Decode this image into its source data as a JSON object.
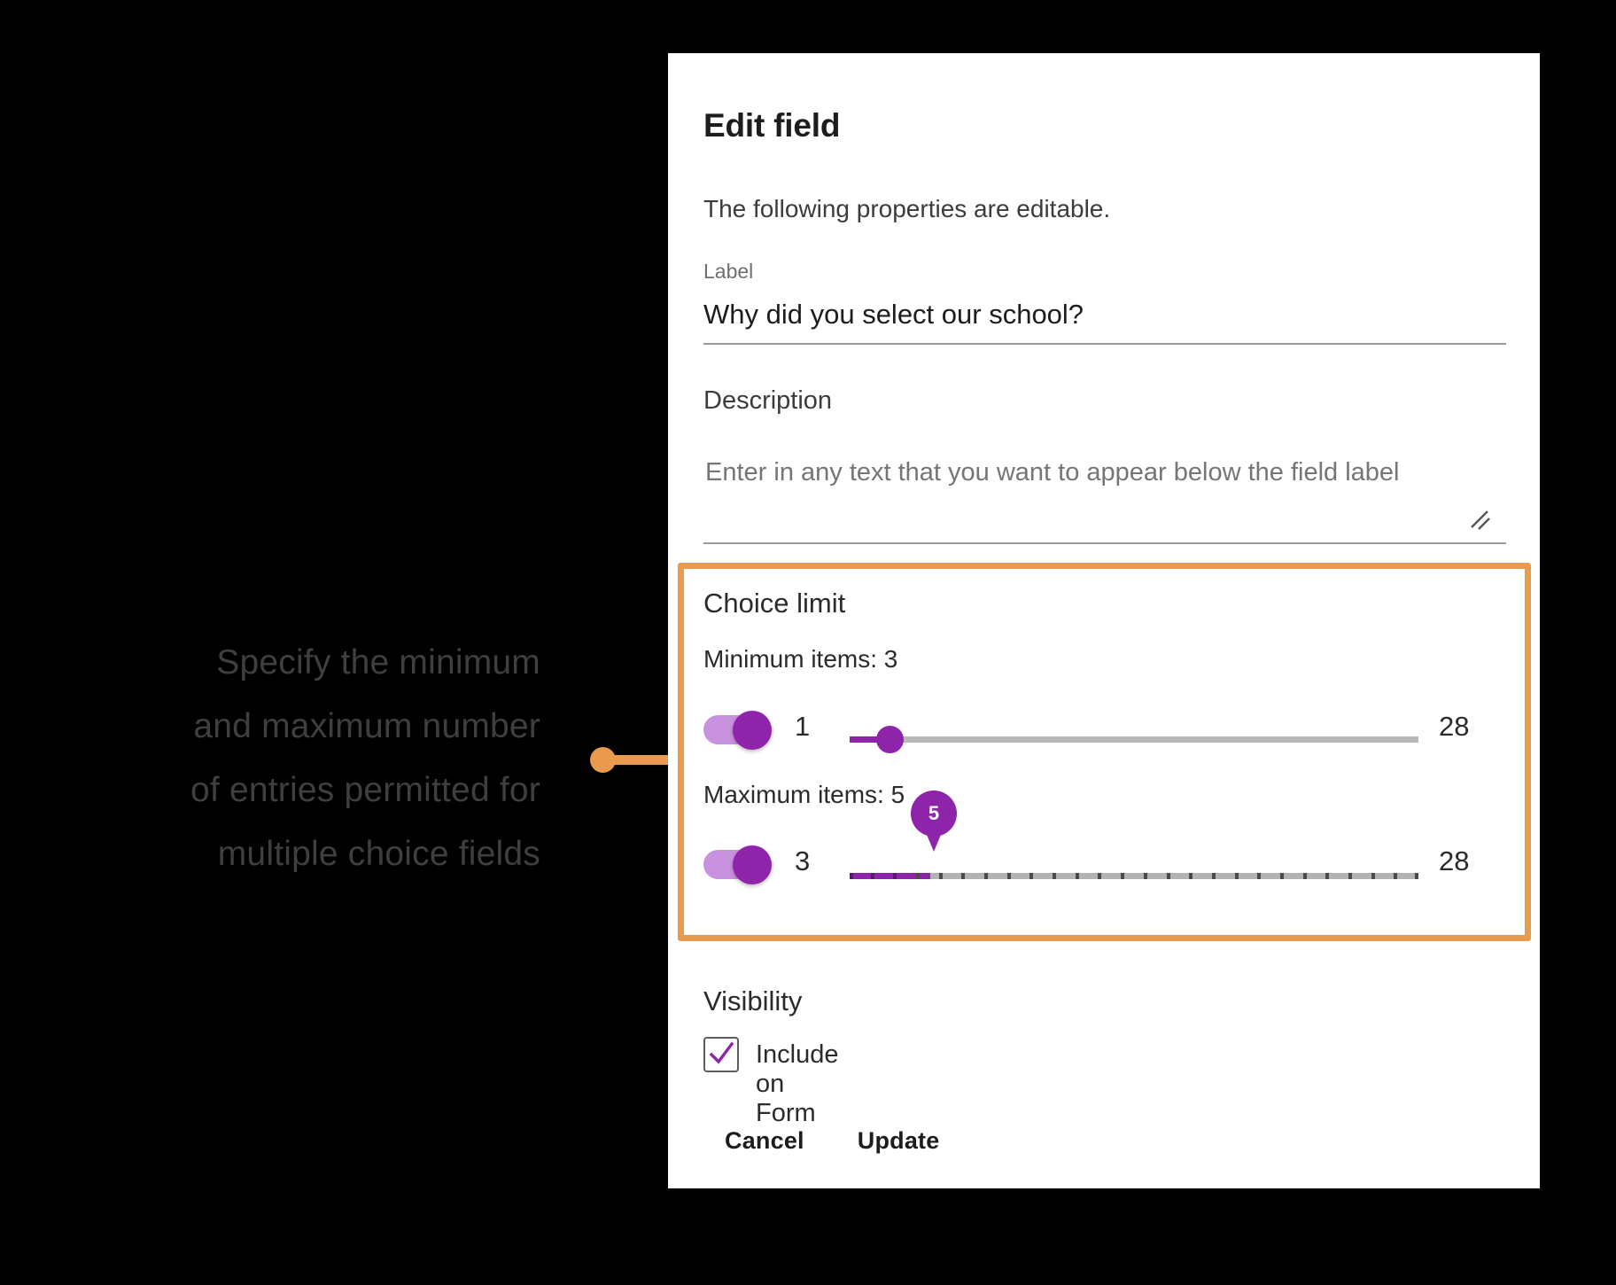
{
  "annotation": {
    "text": "Specify the minimum\nand maximum number\nof entries permitted for\nmultiple choice fields",
    "accent_color": "#e89a4e"
  },
  "dialog": {
    "title": "Edit field",
    "subtitle": "The following properties are editable.",
    "label_field": {
      "caption": "Label",
      "value": "Why did you select our school?",
      "placeholder": "Label"
    },
    "description_field": {
      "caption": "Description",
      "value": "",
      "placeholder": "Enter in any text that you want to appear below the field label"
    },
    "choice_limit": {
      "heading": "Choice limit",
      "minimum": {
        "caption": "Minimum items: 3",
        "toggle_state": "on",
        "low_label": "1",
        "high_label": "28",
        "value": 3,
        "min": 1,
        "max": 28,
        "ticks": false
      },
      "maximum": {
        "caption": "Maximum items: 5",
        "toggle_state": "on",
        "low_label": "3",
        "high_label": "28",
        "value": 5,
        "min": 3,
        "max": 28,
        "ticks": true,
        "pin_value": "5"
      }
    },
    "visibility": {
      "heading": "Visibility",
      "checkbox_label": "Include on Form",
      "checked": true
    },
    "actions": {
      "cancel_label": "Cancel",
      "update_label": "Update"
    },
    "accent_color": "#8e24aa"
  }
}
